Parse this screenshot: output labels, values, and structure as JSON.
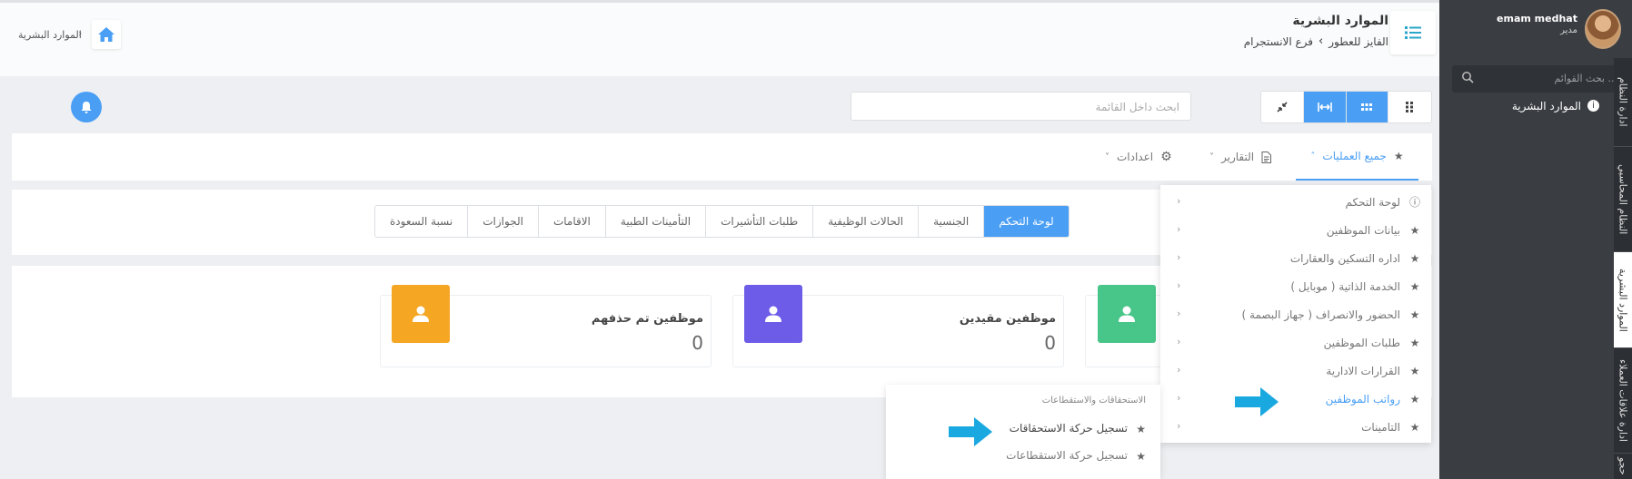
{
  "colors": {
    "accent": "#4a9ff5",
    "sidebar": "#3a3d42",
    "green": "#48c588",
    "purple": "#6c5ce7",
    "orange": "#f5a623",
    "arrow": "#1aa8e0"
  },
  "user": {
    "name": "emam medhat",
    "role": "مدير"
  },
  "sidebar": {
    "search_placeholder": "بحث القوائم ...",
    "menu_item": "الموارد البشرية",
    "vertical_tabs": [
      "ادارة النظام",
      "النظام المحاسبي",
      "الموارد البشرية",
      "ادارة علاقات العملاء",
      "حجو"
    ]
  },
  "header": {
    "title": "الموارد البشرية",
    "company": "الفايز للعطور",
    "branch": "فرع الانستجرام",
    "left_breadcrumb": "الموارد البشرية"
  },
  "toolbar": {
    "search_placeholder": "ابحث داخل القائمة",
    "view_buttons": [
      "grid-small-icon",
      "grid-icon",
      "expand-width-icon",
      "compress-icon"
    ]
  },
  "tabs": [
    {
      "label": "جميع العمليات",
      "icon": "star-icon",
      "active": true
    },
    {
      "label": "التقارير",
      "icon": "document-icon",
      "active": false
    },
    {
      "label": "اعدادات",
      "icon": "gear-icon",
      "active": false
    }
  ],
  "subtabs": [
    "لوحة التحكم",
    "الجنسية",
    "الحالات الوظيفية",
    "طلبات التأشيرات",
    "التأمينات الطبية",
    "الاقامات",
    "الجوازات",
    "نسبة السعودة"
  ],
  "stats": [
    {
      "title": "موظفين مقيدين",
      "count": "0",
      "color": "purple"
    },
    {
      "title": "موظفين تم حذفهم",
      "count": "0",
      "color": "orange"
    }
  ],
  "operations_menu": [
    {
      "label": "لوحة التحكم",
      "icon": "info-icon"
    },
    {
      "label": "بيانات الموظفين",
      "icon": "star-icon"
    },
    {
      "label": "اداره التسكين والعقارات",
      "icon": "star-icon"
    },
    {
      "label": "الخدمة الذاتية ( موبايل )",
      "icon": "star-icon"
    },
    {
      "label": "الحضور والانصراف ( جهاز البصمة )",
      "icon": "star-icon"
    },
    {
      "label": "طلبات الموظفين",
      "icon": "star-icon"
    },
    {
      "label": "القرارات الادارية",
      "icon": "star-icon"
    },
    {
      "label": "رواتب الموظفين",
      "icon": "star-icon",
      "highlighted": true
    },
    {
      "label": "التامينات",
      "icon": "star-icon"
    }
  ],
  "submenu": {
    "heading": "الاستحقاقات والاستقطاعات",
    "items": [
      "تسجيل حركة الاستحقاقات",
      "تسجيل حركة الاستقطاعات"
    ]
  }
}
